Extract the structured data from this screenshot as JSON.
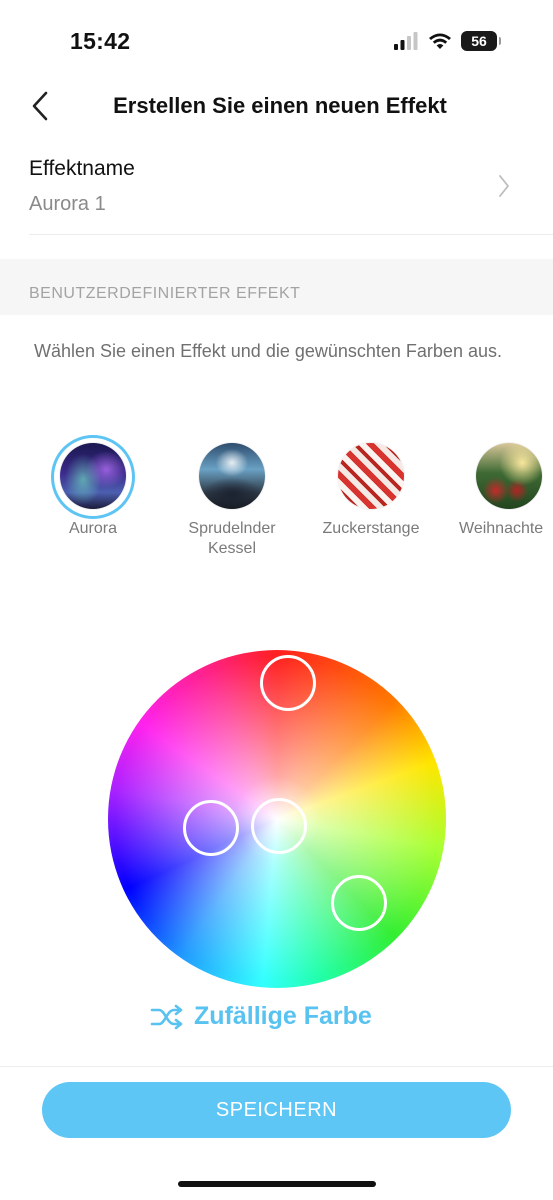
{
  "status_bar": {
    "time": "15:42",
    "battery": "56",
    "icons": [
      "signal-icon",
      "wifi-icon",
      "battery-icon"
    ]
  },
  "header": {
    "back_icon": "chevron-left-icon",
    "title": "Erstellen Sie einen neuen Effekt"
  },
  "effect_name": {
    "label": "Effektname",
    "value": "Aurora 1",
    "chevron_icon": "chevron-right-icon"
  },
  "section": {
    "title": "BENUTZERDEFINIERTER EFFEKT",
    "description": "Wählen Sie einen Effekt und die gewünschten Farben aus."
  },
  "effects": {
    "selected": "Aurora",
    "items": [
      {
        "label": "Aurora",
        "selected": true
      },
      {
        "label": "Sprudelnder Kessel",
        "selected": false
      },
      {
        "label": "Zuckerstange",
        "selected": false
      },
      {
        "label": "Weihnachte",
        "selected": false
      }
    ]
  },
  "color_picker": {
    "handle_count": 4,
    "handle_colors": [
      "#e8483a",
      "#b7a6f5",
      "#f3f2ff",
      "#7ef76a"
    ]
  },
  "random_color": {
    "icon": "shuffle-icon",
    "label": "Zufällige Farbe"
  },
  "save_button": {
    "label": "SPEICHERN"
  },
  "colors": {
    "accent": "#5ec4f3",
    "save_button_bg": "#5dc6f5",
    "section_bg": "#f6f6f6"
  }
}
